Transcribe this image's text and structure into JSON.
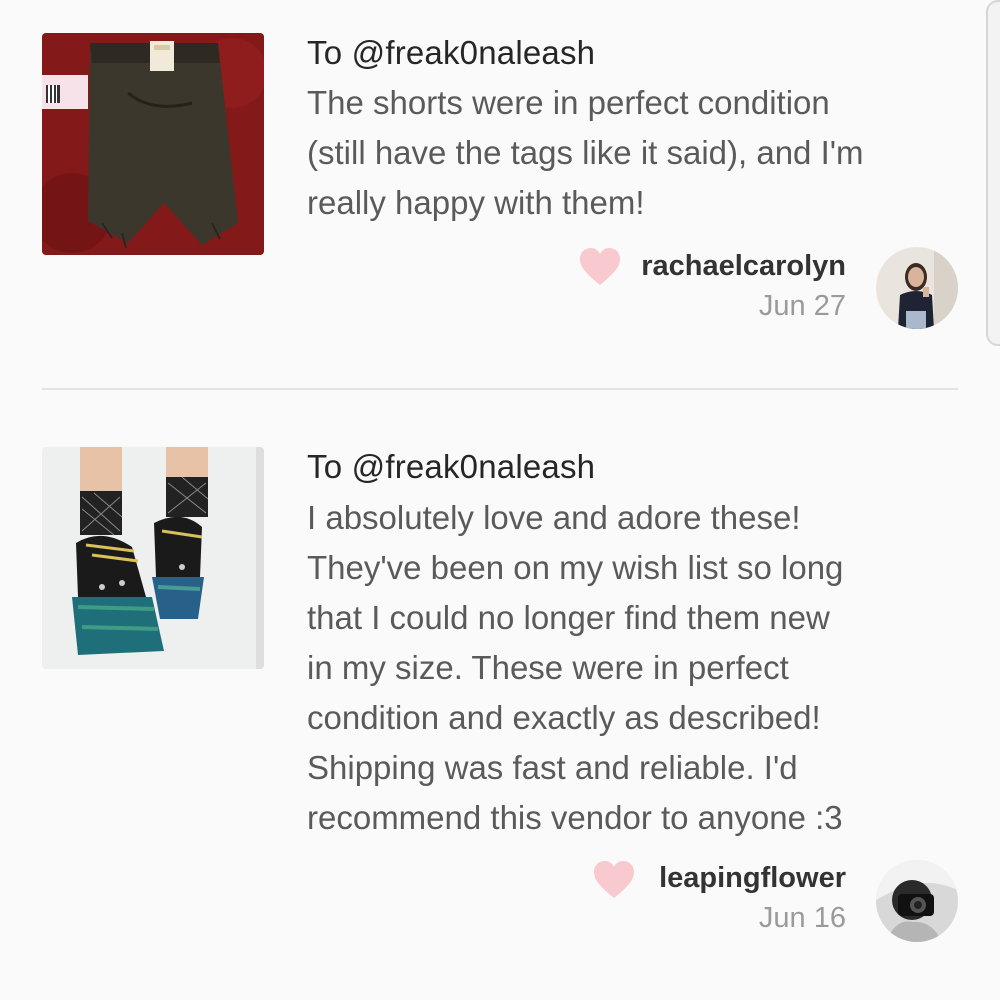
{
  "reviews": [
    {
      "recipient": "To @freak0naleash",
      "body": "The shorts were in perfect condition\n(still have the tags like it said), and I'm\nreally happy with them!",
      "reviewer": "rachaelcarolyn",
      "date": "Jun 27",
      "item_icon": "shorts-photo",
      "heart_color": "#f8c9cf"
    },
    {
      "recipient": "To @freak0naleash",
      "body": "I absolutely love and adore these!\nThey've been on my wish list so long\nthat I could no longer find them new\nin my size. These were in perfect\ncondition and exactly as described!\nShipping was fast and reliable. I'd\nrecommend this vendor to anyone :3",
      "reviewer": "leapingflower",
      "date": "Jun 16",
      "item_icon": "platform-shoes-photo",
      "heart_color": "#f8c9cf"
    }
  ]
}
